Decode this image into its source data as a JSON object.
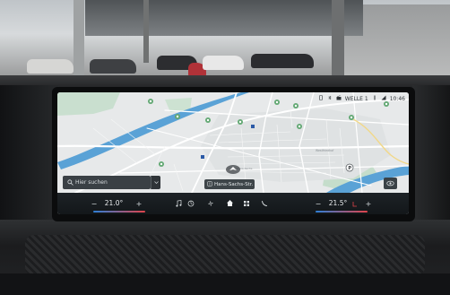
{
  "status_bar": {
    "radio_station": "WELLE 1",
    "time": "10:46",
    "icons": [
      "phone-icon",
      "bluetooth-icon",
      "radio-icon",
      "signal-icon",
      "battery-icon"
    ]
  },
  "map": {
    "search_placeholder": "Hier suchen",
    "current_street": "Hans-Sachs-Str.",
    "colors": {
      "land": "#e7e9ea",
      "river": "#5aa2d6",
      "park": "#b5d9bf",
      "road_major": "#ffffff",
      "poi": "#62a873"
    }
  },
  "control_bar": {
    "driver_temp": "21.0°",
    "passenger_temp": "21.5°",
    "minus": "−",
    "plus": "+",
    "icons": [
      "seat-heat-icon",
      "music-icon",
      "climate-icon",
      "fan-icon",
      "home-icon",
      "apps-icon",
      "phone-icon",
      "seat-heat-icon"
    ]
  }
}
